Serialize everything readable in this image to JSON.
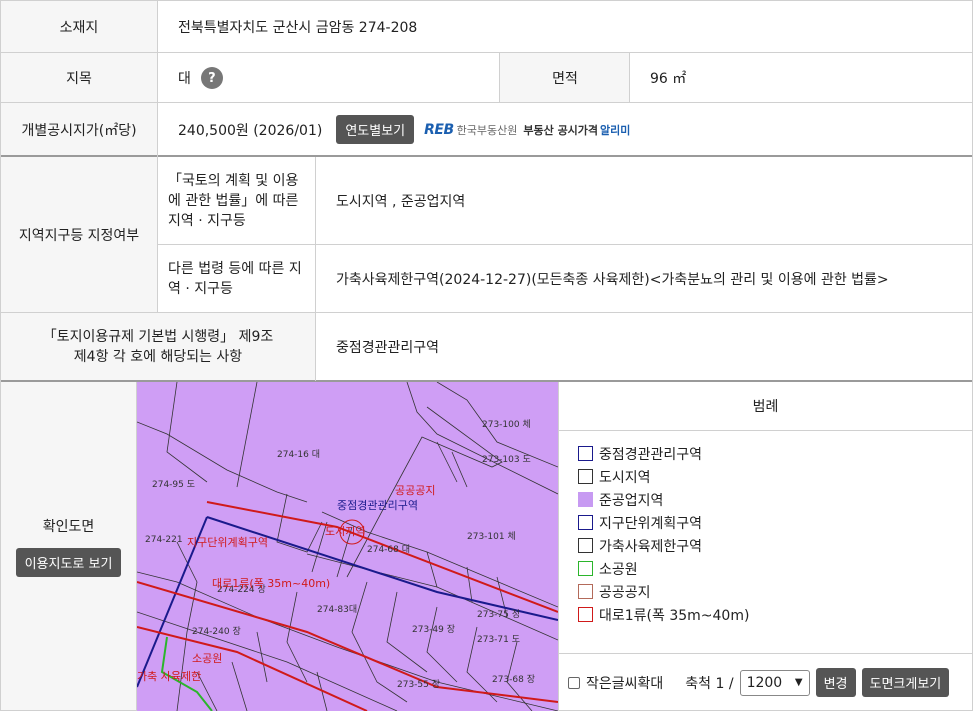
{
  "location": {
    "label": "소재지",
    "value": "전북특별자치도 군산시 금암동 274-208"
  },
  "jimok": {
    "label": "지목",
    "value": "대",
    "help_icon": "?"
  },
  "area": {
    "label": "면적",
    "value": "96 ㎡"
  },
  "price": {
    "label": "개별공시지가(㎡당)",
    "value": "240,500원 (2026/01)",
    "button": "연도별보기",
    "reb_logo": "REB",
    "reb_org": "한국부동산원",
    "reb_text": "부동산 공시가격",
    "reb_highlight": "알리미"
  },
  "zone": {
    "label": "지역지구등 지정여부",
    "law1_label": "「국토의 계획 및 이용에 관한 법률」에 따른 지역 · 지구등",
    "law1_value": "도시지역 , 준공업지역",
    "law2_label": "다른 법령 등에 따른 지역 · 지구등",
    "law2_value": "가축사육제한구역(2024-12-27)(모든축종 사육제한)<가축분뇨의 관리 및 이용에 관한 법률>"
  },
  "regulation": {
    "label": "「토지이용규제 기본법 시행령」 제9조 제4항 각 호에 해당되는 사항",
    "value": "중점경관관리구역"
  },
  "confirm": {
    "label": "확인도면",
    "button": "이용지도로 보기"
  },
  "map_labels": {
    "p1": "273-100 체",
    "p2": "274-16 대",
    "p3": "273-101 체",
    "p4": "274-68 대",
    "p5": "274-224 장",
    "p6": "274-83대",
    "p7": "274-240 장",
    "p8": "273-75 정",
    "p9": "273-71 도",
    "p10": "273-68 장",
    "p11": "274-221",
    "p12": "274-95 도",
    "p13": "273-55 장",
    "p14": "273-49 장",
    "p15": "273-103 도",
    "z1": "중점경관관리구역",
    "z2": "공공공지",
    "z3": "지구단위계획구역",
    "z4": "도시지역",
    "z5": "대로1류(폭 35m~40m)",
    "z6": "소공원",
    "z7": "가축 사육제한"
  },
  "legend": {
    "title": "범례",
    "items": [
      {
        "label": "중점경관관리구역",
        "border": "#1a1a8c",
        "fill": "#ffffff"
      },
      {
        "label": "도시지역",
        "border": "#333333",
        "fill": "#ffffff"
      },
      {
        "label": "준공업지역",
        "border": "#c79af2",
        "fill": "#c79af2"
      },
      {
        "label": "지구단위계획구역",
        "border": "#1a1a8c",
        "fill": "#ffffff"
      },
      {
        "label": "가축사육제한구역",
        "border": "#333333",
        "fill": "#ffffff"
      },
      {
        "label": "소공원",
        "border": "#2bb52b",
        "fill": "#ffffff"
      },
      {
        "label": "공공공지",
        "border": "#b36a5a",
        "fill": "#ffffff"
      },
      {
        "label": "대로1류(폭 35m~40m)",
        "border": "#d01a1a",
        "fill": "#ffffff"
      }
    ],
    "small_text": "작은글씨확대",
    "scale_label": "축척 1 /",
    "scale_value": "1200",
    "change_button": "변경",
    "big_button": "도면크게보기"
  }
}
